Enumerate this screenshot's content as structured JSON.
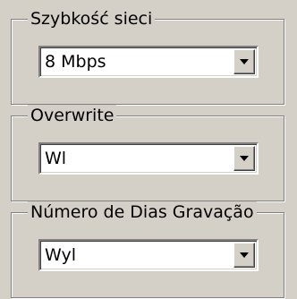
{
  "groups": [
    {
      "label": "Szybkość sieci",
      "value": "8 Mbps"
    },
    {
      "label": "Overwrite",
      "value": "Wl"
    },
    {
      "label": "Número de Dias Gravação",
      "value": "Wyl"
    }
  ],
  "icons": {
    "dropdown": "chevron-down-icon"
  },
  "colors": {
    "face": "#d4d0c8",
    "shadow": "#808080",
    "highlight": "#ffffff",
    "field": "#ffffff"
  }
}
